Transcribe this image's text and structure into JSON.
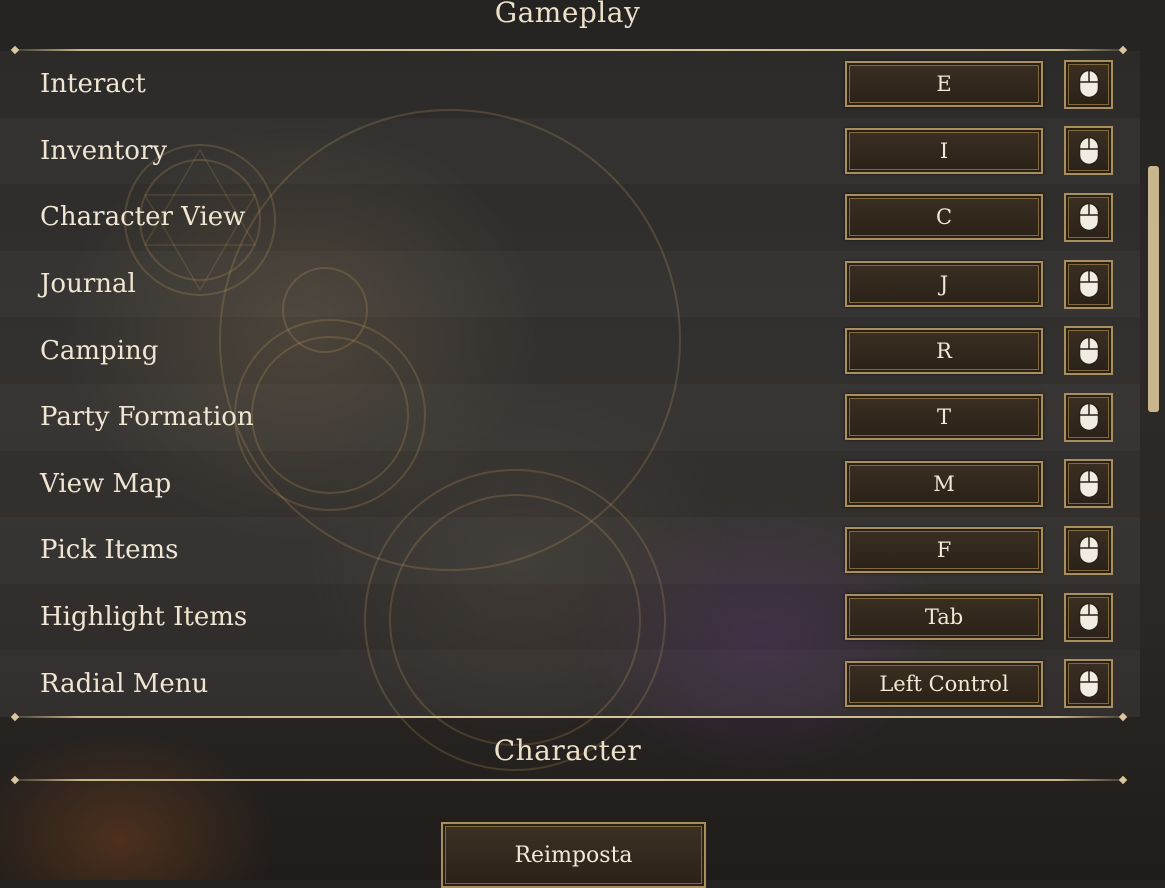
{
  "sections": {
    "gameplay_title": "Gameplay",
    "character_title": "Character"
  },
  "keybinds": [
    {
      "action": "Interact",
      "key": "E"
    },
    {
      "action": "Inventory",
      "key": "I"
    },
    {
      "action": "Character View",
      "key": "C"
    },
    {
      "action": "Journal",
      "key": "J"
    },
    {
      "action": "Camping",
      "key": "R"
    },
    {
      "action": "Party Formation",
      "key": "T"
    },
    {
      "action": "View Map",
      "key": "M"
    },
    {
      "action": "Pick Items",
      "key": "F"
    },
    {
      "action": "Highlight Items",
      "key": "Tab"
    },
    {
      "action": "Radial Menu",
      "key": "Left Control"
    }
  ],
  "icons": {
    "mouse_button": "mouse-icon"
  },
  "footer": {
    "reset_label": "Reimposta"
  },
  "colors": {
    "accent_gold": "#a88f5d",
    "text": "#efe5d2",
    "scrollbar": "#c9b58e"
  }
}
